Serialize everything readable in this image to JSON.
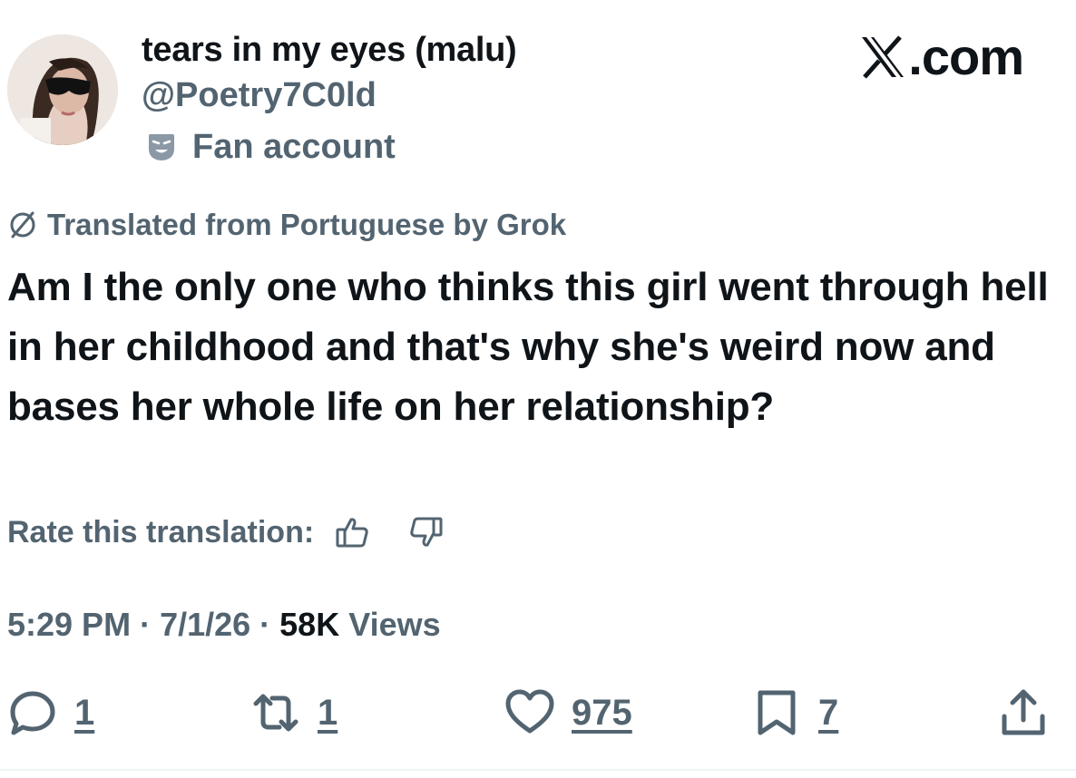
{
  "author": {
    "display_name": "tears in my eyes (malu)",
    "handle": "@Poetry7C0ld",
    "badge_label": "Fan account",
    "avatar_icon": "profile-photo"
  },
  "brand": {
    "label": ".com",
    "icon": "x-logo"
  },
  "translation": {
    "notice": "Translated from Portuguese by Grok",
    "icon": "translate-icon"
  },
  "tweet": {
    "text": "Am I the only one who thinks this girl went through hell in her childhood and that's why she's weird now and bases her whole life on her relationship?"
  },
  "rating": {
    "label": "Rate this translation:",
    "up_icon": "thumbs-up-icon",
    "down_icon": "thumbs-down-icon"
  },
  "meta": {
    "time": "5:29 PM",
    "separator": "·",
    "date": "7/1/26",
    "views_count": "58K",
    "views_label": "Views"
  },
  "actions": {
    "reply": {
      "count": "1",
      "icon": "reply-icon"
    },
    "repost": {
      "count": "1",
      "icon": "repost-icon"
    },
    "like": {
      "count": "975",
      "icon": "heart-icon"
    },
    "bookmark": {
      "count": "7",
      "icon": "bookmark-icon"
    },
    "share": {
      "icon": "share-icon"
    }
  },
  "colors": {
    "text_primary": "#0f1419",
    "text_secondary": "#536471",
    "background": "#ffffff"
  }
}
